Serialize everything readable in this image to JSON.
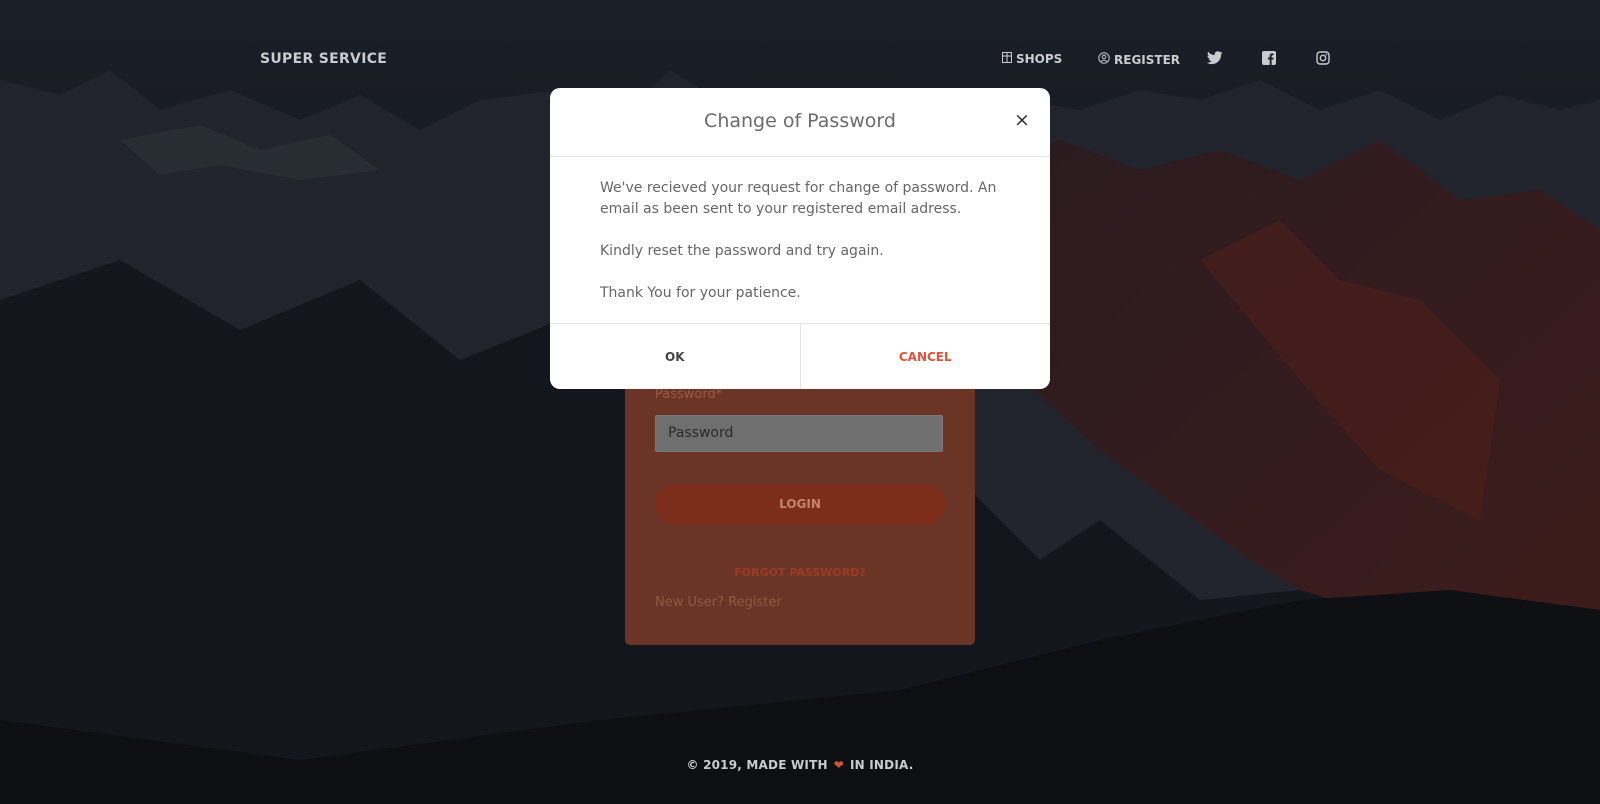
{
  "navbar": {
    "brand": "SUPER SERVICE",
    "links": [
      {
        "label": "SHOPS",
        "icon": "store-icon"
      },
      {
        "label": "REGISTER",
        "icon": "user-circle-icon"
      }
    ],
    "social": [
      "twitter-icon",
      "facebook-icon",
      "instagram-icon"
    ]
  },
  "login": {
    "password_label": "Password*",
    "password_placeholder": "Password",
    "login_button": "LOGIN",
    "forgot_link": "FORGOT PASSWORD?",
    "new_user": "New User? Register"
  },
  "modal": {
    "title": "Change of Password",
    "close_symbol": "×",
    "paragraphs": [
      "We've recieved your request for change of password. An email as been sent to your registered email adress.",
      "Kindly reset the password and try again.",
      "Thank You for your patience."
    ],
    "ok_label": "OK",
    "cancel_label": "CANCEL"
  },
  "footer": {
    "prefix": "© 2019, MADE WITH",
    "heart": "❤",
    "suffix": "IN INDIA."
  },
  "colors": {
    "accent": "#e0533a",
    "login_card": "#6a3527",
    "background": "#1b2029"
  }
}
